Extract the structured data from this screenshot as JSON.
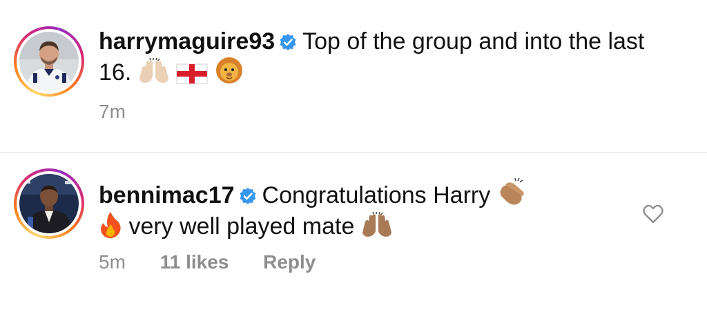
{
  "comments": [
    {
      "username": "harrymaguire93",
      "text_part1": "Top of the group and into the last 16.",
      "emojis": [
        "raising-hands",
        "england-flag",
        "lion-face"
      ],
      "time": "7m",
      "likes": "",
      "reply": ""
    },
    {
      "username": "bennimac17",
      "text_part1": "Congratulations Harry",
      "text_part2": "very well played mate",
      "emojis": [
        "clapping-hands",
        "fire",
        "raising-hands"
      ],
      "time": "5m",
      "likes": "11 likes",
      "reply": "Reply"
    }
  ],
  "colors": {
    "verified": "#3797f0",
    "meta_text": "#8e8e8e",
    "divider": "#dbdbdb"
  }
}
